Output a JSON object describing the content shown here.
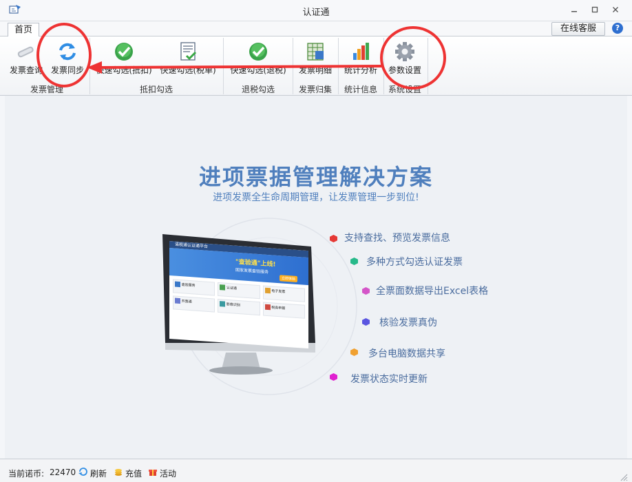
{
  "window": {
    "title": "认证通"
  },
  "tabs": [
    {
      "label": "首页"
    }
  ],
  "header": {
    "service_label": "在线客服",
    "help": "?"
  },
  "ribbon": {
    "buttons": [
      {
        "label": "发票查询",
        "icon": "invoice-search-icon"
      },
      {
        "label": "发票同步",
        "icon": "sync-icon"
      },
      {
        "label": "快速勾选(抵扣)",
        "icon": "check-icon"
      },
      {
        "label": "快速勾选(税单)",
        "icon": "tax-form-icon"
      },
      {
        "label": "快速勾选(退税)",
        "icon": "check-icon"
      },
      {
        "label": "发票明细",
        "icon": "spreadsheet-icon"
      },
      {
        "label": "统计分析",
        "icon": "bar-chart-icon"
      },
      {
        "label": "参数设置",
        "icon": "gear-icon"
      }
    ],
    "groups": [
      "发票管理",
      "抵扣勾选",
      "退税勾选",
      "发票归集",
      "统计信息",
      "系统设置"
    ]
  },
  "main": {
    "title": "进项票据管理解决方案",
    "subtitle": "进项发票全生命周期管理，让发票管理一步到位!",
    "features": [
      {
        "text": "支持查找、预览发票信息",
        "color": "#e53935"
      },
      {
        "text": "多种方式勾选认证发票",
        "color": "#26b98a"
      },
      {
        "text": "全票面数据导出Excel表格",
        "color": "#d455c8"
      },
      {
        "text": "核验发票真伪",
        "color": "#5a55e0"
      },
      {
        "text": "多台电脑数据共享",
        "color": "#f0a030"
      },
      {
        "text": "发票状态实时更新",
        "color": "#e020d0"
      }
    ],
    "monitor": {
      "screen_title": "诺税通认证通平台",
      "banner_title": "\"查验通\"上线!",
      "banner_sub": "国家发票查验服务",
      "action": "立即体验",
      "app_names": [
        "查验服务",
        "认证通",
        "电子发票",
        "开票通",
        "影像识别",
        "税务申报"
      ]
    }
  },
  "statusbar": {
    "coins_label": "当前诺币:",
    "coins_value": "22470",
    "refresh_label": "刷新",
    "recharge_label": "充值",
    "activity_label": "活动"
  },
  "colors": {
    "accent": "#4f7fbd",
    "annotation": "#ee3333"
  }
}
